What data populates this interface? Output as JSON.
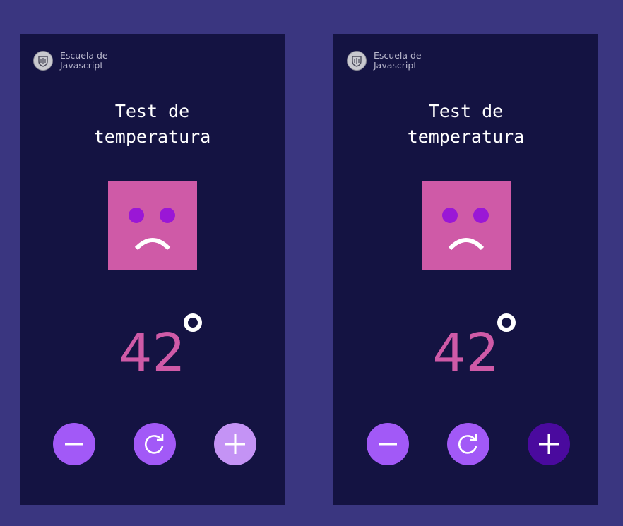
{
  "brand": {
    "line1": "Escuela de",
    "line2": "Javascript"
  },
  "panels": [
    {
      "title_line1": "Test de",
      "title_line2": "temperatura",
      "temperature": "42",
      "buttons": {
        "minus_color": "#a259f7",
        "reset_color": "#a259f7",
        "plus_color": "#c493f5"
      },
      "state": "plus-hover"
    },
    {
      "title_line1": "Test de",
      "title_line2": "temperatura",
      "temperature": "42",
      "buttons": {
        "minus_color": "#a259f7",
        "reset_color": "#a259f7",
        "plus_color": "#4a0a9e"
      },
      "state": "plus-active"
    }
  ],
  "colors": {
    "background": "#3a3680",
    "panel": "#141342",
    "face": "#cf5aa7",
    "eyes": "#9a17d6",
    "temperature": "#cf5aa7",
    "text": "#ffffff"
  },
  "icons": [
    "school-crest-icon",
    "sad-face-icon",
    "degree-icon",
    "minus-icon",
    "reset-icon",
    "plus-icon"
  ]
}
